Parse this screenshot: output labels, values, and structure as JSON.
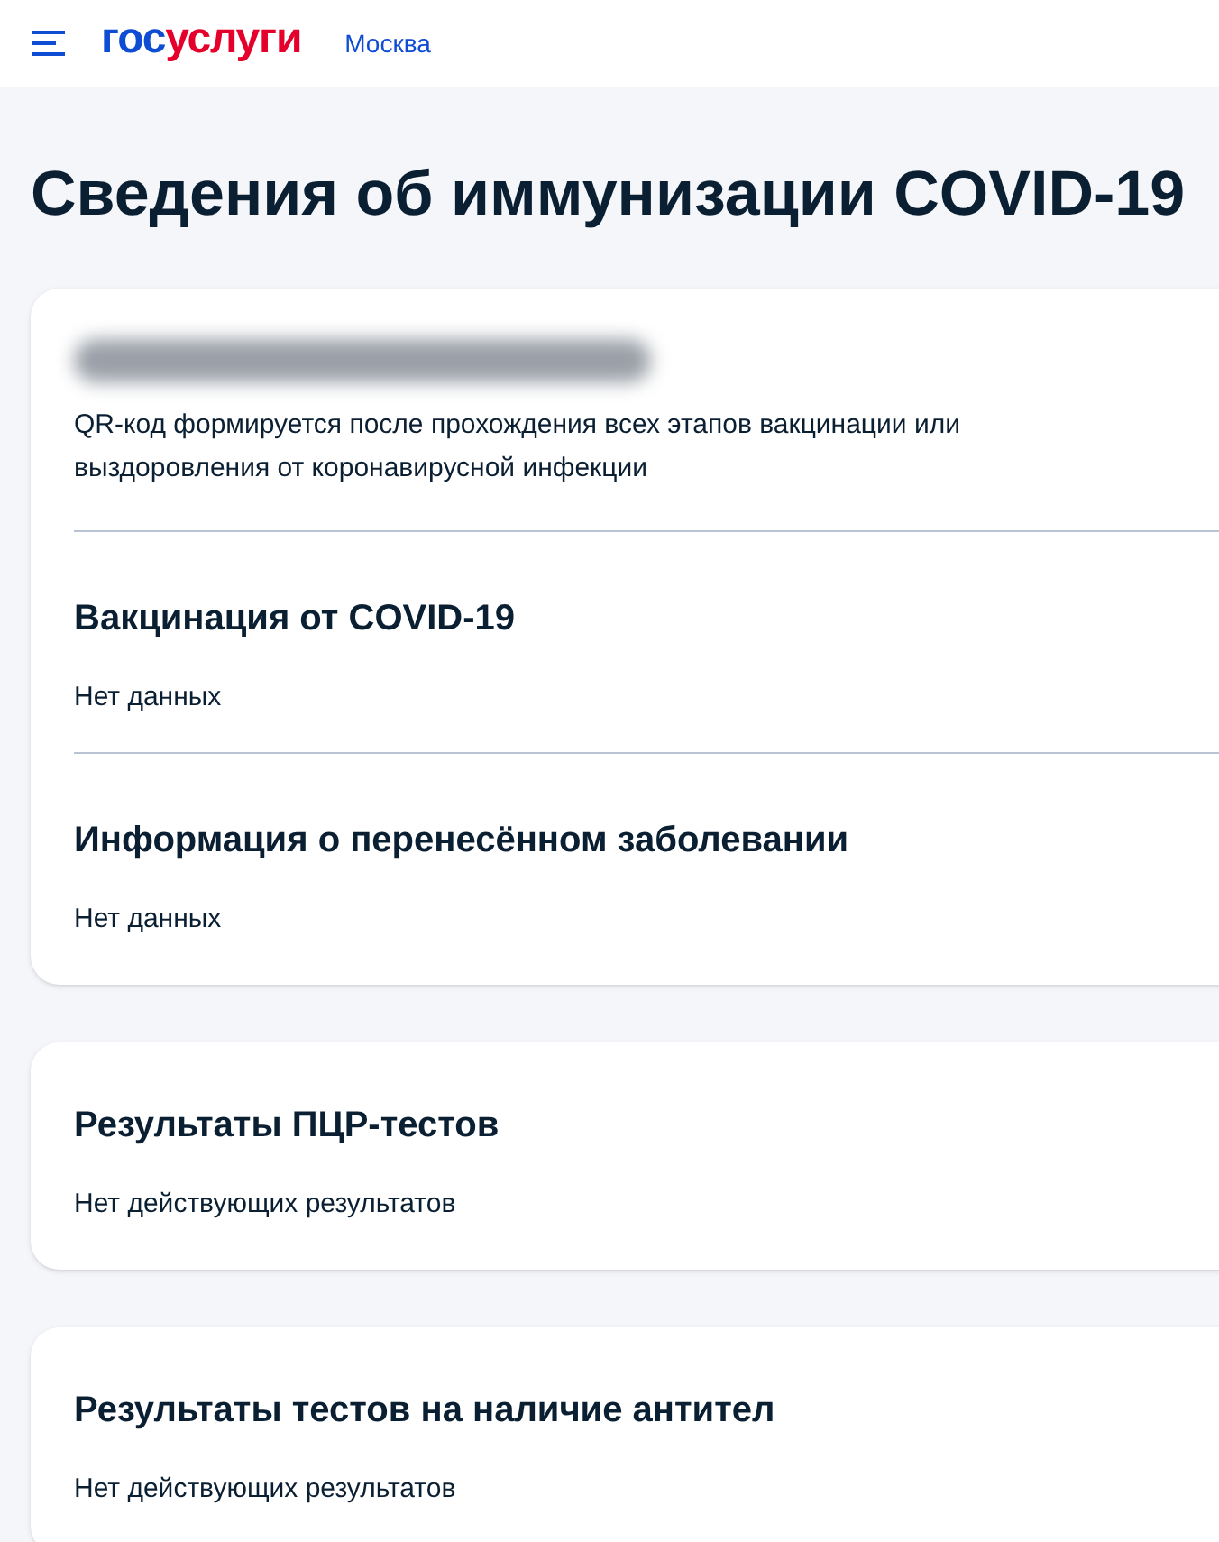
{
  "header": {
    "logo": [
      "гос",
      "услуги"
    ],
    "city": "Москва"
  },
  "title": "Сведения об иммунизации COVID-19",
  "cards": [
    {
      "redacted_name": true,
      "note": "QR-код формируется после прохождения всех этапов вакцинации или выздоровления от коронавирусной инфекции",
      "sections": [
        {
          "title": "Вакцинация от COVID-19",
          "value": "Нет данных"
        },
        {
          "title": "Информация о перенесённом заболевании",
          "value": "Нет данных"
        }
      ]
    },
    {
      "sections": [
        {
          "title": "Результаты ПЦР-тестов",
          "value": "Нет действующих результатов"
        }
      ]
    },
    {
      "sections": [
        {
          "title": "Результаты тестов на наличие антител",
          "value": "Нет действующих результатов"
        }
      ]
    }
  ]
}
